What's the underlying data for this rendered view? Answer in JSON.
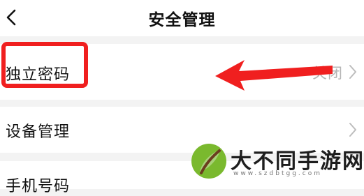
{
  "header": {
    "title": "安全管理",
    "back_icon": "chevron-left-icon"
  },
  "settings": {
    "items": [
      {
        "label": "独立密码",
        "value": "关闭",
        "icon": "chevron-right-icon"
      },
      {
        "label": "设备管理",
        "value": "",
        "icon": "chevron-right-icon"
      },
      {
        "label": "手机号码",
        "value": "",
        "icon": ""
      }
    ]
  },
  "annotation": {
    "color": "#f01f1f",
    "target": "独立密码"
  },
  "watermark": {
    "title": "大不同手游网",
    "url": "www.szdbtgg.com",
    "logo_color": "#7ab92e"
  }
}
